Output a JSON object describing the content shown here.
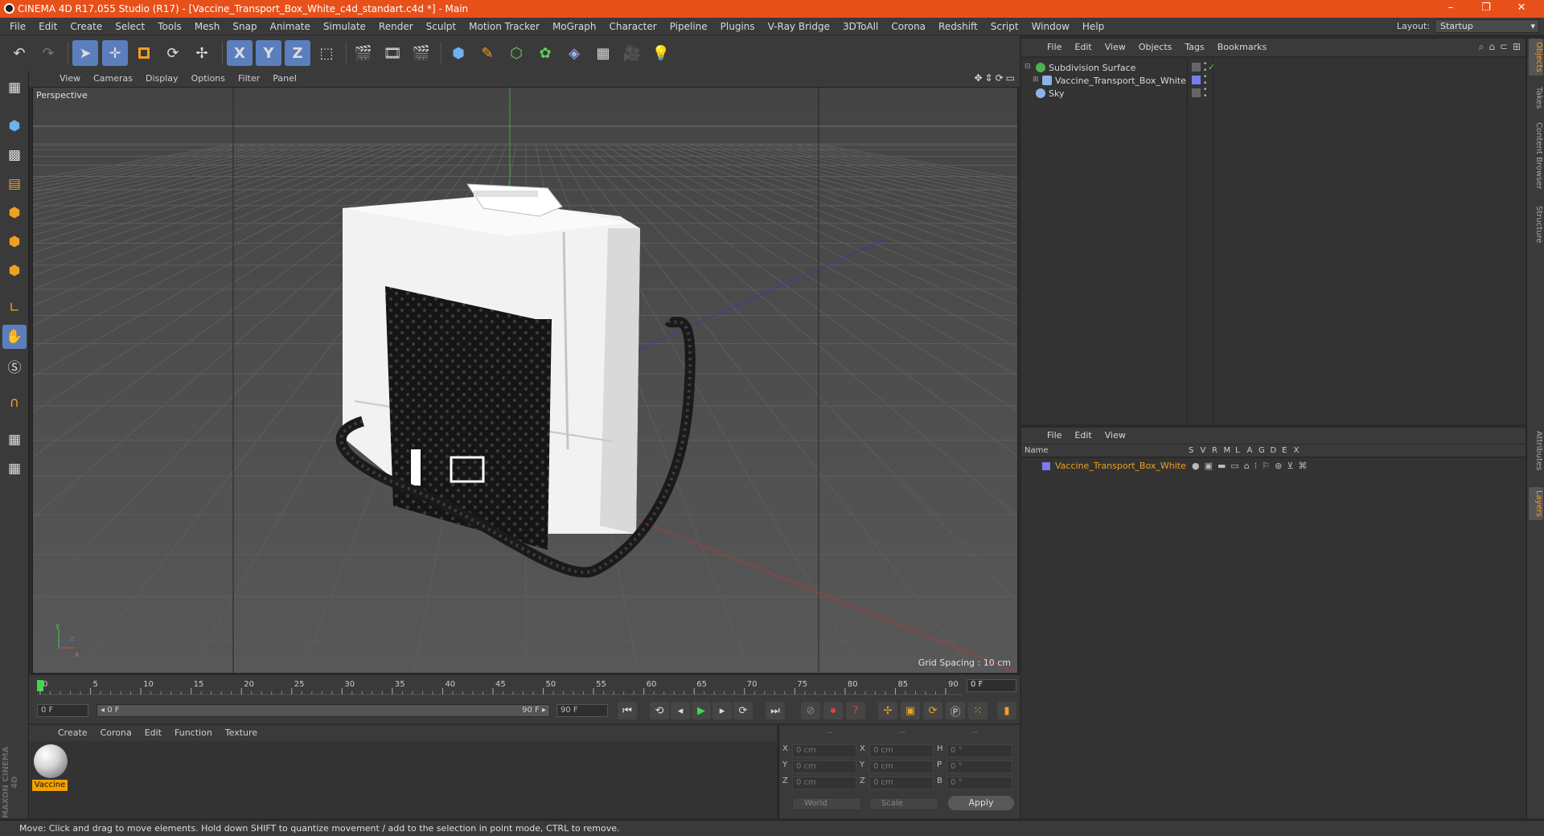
{
  "window": {
    "title": "CINEMA 4D R17.055 Studio (R17) - [Vaccine_Transport_Box_White_c4d_standart.c4d *] - Main",
    "controls": [
      "–",
      "❐",
      "✕"
    ]
  },
  "menubar": {
    "items": [
      "File",
      "Edit",
      "Create",
      "Select",
      "Tools",
      "Mesh",
      "Snap",
      "Animate",
      "Simulate",
      "Render",
      "Sculpt",
      "Motion Tracker",
      "MoGraph",
      "Character",
      "Pipeline",
      "Plugins",
      "V-Ray Bridge",
      "3DToAll",
      "Corona",
      "Redshift",
      "Script",
      "Window",
      "Help"
    ],
    "layout_label": "Layout:",
    "layout_value": "Startup"
  },
  "toolbar": {
    "axis_x": "X",
    "axis_y": "Y",
    "axis_z": "Z"
  },
  "viewport": {
    "menu": [
      "View",
      "Cameras",
      "Display",
      "Options",
      "Filter",
      "Panel"
    ],
    "camera_label": "Perspective",
    "grid_spacing": "Grid Spacing : 10 cm",
    "nav_icons": [
      "✥",
      "⇕",
      "⟳",
      "▭"
    ],
    "axis_gizmo": {
      "y": "y",
      "z": "z",
      "x": "x"
    }
  },
  "timeline": {
    "ticks": [
      0,
      5,
      10,
      15,
      20,
      25,
      30,
      35,
      40,
      45,
      50,
      55,
      60,
      65,
      70,
      75,
      80,
      85,
      90
    ],
    "current_frame_field": "0 F",
    "start_field": "0 F",
    "range_start": "◂ 0 F",
    "range_end": "90 F ▸",
    "end_field": "90 F"
  },
  "material_manager": {
    "menu": [
      "Create",
      "Corona",
      "Edit",
      "Function",
      "Texture"
    ],
    "materials": [
      {
        "name": "Vaccine"
      }
    ],
    "brand": "MAXON CINEMA 4D"
  },
  "coordinates": {
    "headers": [
      "--",
      "--",
      "--"
    ],
    "rows": [
      {
        "a": "X",
        "av": "0 cm",
        "b": "X",
        "bv": "0 cm",
        "c": "H",
        "cv": "0 °"
      },
      {
        "a": "Y",
        "av": "0 cm",
        "b": "Y",
        "bv": "0 cm",
        "c": "P",
        "cv": "0 °"
      },
      {
        "a": "Z",
        "av": "0 cm",
        "b": "Z",
        "bv": "0 cm",
        "c": "B",
        "cv": "0 °"
      }
    ],
    "mode_world": "World",
    "mode_scale": "Scale",
    "apply": "Apply"
  },
  "object_manager": {
    "menu": [
      "File",
      "Edit",
      "View",
      "Objects",
      "Tags",
      "Bookmarks"
    ],
    "objects": [
      {
        "name": "Subdivision Surface",
        "icon_color": "#4fb04f"
      },
      {
        "name": "Vaccine_Transport_Box_White",
        "icon_color": "#8ab4e8"
      },
      {
        "name": "Sky",
        "icon_color": "#8ab4e8"
      }
    ]
  },
  "layer_manager": {
    "menu": [
      "File",
      "Edit",
      "View"
    ],
    "columns": [
      "Name",
      "S",
      "V",
      "R",
      "M",
      "L",
      "A",
      "G",
      "D",
      "E",
      "X"
    ],
    "layers": [
      {
        "name": "Vaccine_Transport_Box_White",
        "color": "#7b7bf0"
      }
    ]
  },
  "side_tabs": {
    "top": [
      "Objects",
      "Takes",
      "Content Browser",
      "Structure"
    ],
    "bottom": [
      "Attributes",
      "Layers"
    ]
  },
  "status": {
    "text": "Move: Click and drag to move elements. Hold down SHIFT to quantize movement / add to the selection in point mode, CTRL to remove."
  },
  "colors": {
    "title_bar": "#e8501a",
    "selection": "#5b7fbd",
    "layer_name": "#f0a020"
  }
}
